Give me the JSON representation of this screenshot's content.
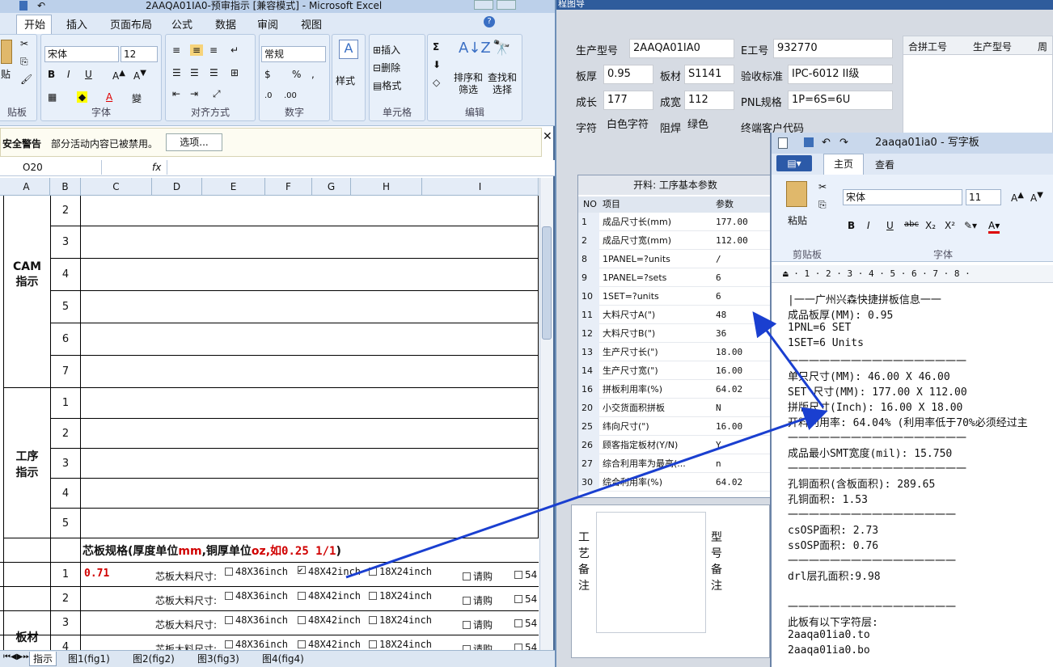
{
  "erp": {
    "title": "程图导",
    "form": [
      {
        "label": "生产型号",
        "value": "2AAQA01IA0"
      },
      {
        "label": "E工号",
        "value": "932770"
      },
      {
        "label": "板厚",
        "value": "0.95"
      },
      {
        "label": "板材",
        "value": "S1141"
      },
      {
        "label": "验收标准",
        "value": "IPC-6012 II级"
      },
      {
        "label": "成长",
        "value": "177"
      },
      {
        "label": "成宽",
        "value": "112"
      },
      {
        "label": "PNL规格",
        "value": "1P=6S=6U"
      },
      {
        "label": "字符",
        "value": "白色字符"
      },
      {
        "label": "阻焊",
        "value": "绿色"
      },
      {
        "label": "终端客户代码",
        "value": ""
      }
    ],
    "right_headers": [
      "合拼工号",
      "生产型号",
      "周期"
    ],
    "grid_title": "开料: 工序基本参数",
    "grid_headers": [
      "NO",
      "项目",
      "参数"
    ],
    "grid_rows": [
      {
        "no": "1",
        "item": "成品尺寸长(mm)",
        "val": "177.00"
      },
      {
        "no": "2",
        "item": "成品尺寸宽(mm)",
        "val": "112.00"
      },
      {
        "no": "8",
        "item": "1PANEL=?units",
        "val": "/"
      },
      {
        "no": "9",
        "item": "1PANEL=?sets",
        "val": "6"
      },
      {
        "no": "10",
        "item": "1SET=?units",
        "val": "6"
      },
      {
        "no": "11",
        "item": "大料尺寸A(\")",
        "val": "48"
      },
      {
        "no": "12",
        "item": "大料尺寸B(\")",
        "val": "36"
      },
      {
        "no": "13",
        "item": "生产尺寸长(\")",
        "val": "18.00"
      },
      {
        "no": "14",
        "item": "生产尺寸宽(\")",
        "val": "16.00"
      },
      {
        "no": "16",
        "item": "拼板利用率(%)",
        "val": "64.02"
      },
      {
        "no": "20",
        "item": "小交货面积拼板",
        "val": "N"
      },
      {
        "no": "25",
        "item": "纬向尺寸(\")",
        "val": "16.00"
      },
      {
        "no": "26",
        "item": "顾客指定板材(Y/N)",
        "val": "Y"
      },
      {
        "no": "27",
        "item": "综合利用率为最高(...",
        "val": "n"
      },
      {
        "no": "30",
        "item": "综合利用率(%)",
        "val": "64.02"
      }
    ],
    "remark1": "工艺备注",
    "remark2": "型号备注"
  },
  "excel": {
    "title": "2AAQA01IA0-预审指示 [兼容模式] - Microsoft Excel",
    "tabs": [
      "开始",
      "插入",
      "页面布局",
      "公式",
      "数据",
      "审阅",
      "视图"
    ],
    "font_name": "宋体",
    "font_size": "12",
    "number_format": "常规",
    "groups": {
      "clipboard": "贴板",
      "font": "字体",
      "align": "对齐方式",
      "number": "数字",
      "styles": "样式",
      "cells": "单元格",
      "edit": "编辑"
    },
    "paste": "贴",
    "cell_btns": [
      "插入",
      "删除",
      "格式"
    ],
    "edit_btns": [
      "排序和\n筛选",
      "查找和\n选择"
    ],
    "security_label": "安全警告",
    "security_msg": "部分活动内容已被禁用。",
    "options_btn": "选项...",
    "namebox": "O20",
    "fx": "fx",
    "columns": [
      "A",
      "B",
      "C",
      "D",
      "E",
      "F",
      "G",
      "H",
      "I"
    ],
    "cam_label": "CAM\n指示",
    "cam_rows": [
      "2",
      "3",
      "4",
      "5",
      "6",
      "7"
    ],
    "proc_label": "工序\n指示",
    "proc_rows": [
      "1",
      "2",
      "3",
      "4",
      "5"
    ],
    "board_label": "板材",
    "core_title_a": "芯板规格(厚度单位",
    "core_title_mm": "mm",
    "core_title_b": ",铜厚单位",
    "core_title_oz": "oz",
    "core_title_c": ",如",
    "core_title_d": "0.25 1/1",
    ")": ")",
    "core_close": ")",
    "core_rows": [
      {
        "n": "1",
        "v": "0.71"
      },
      {
        "n": "2",
        "v": ""
      },
      {
        "n": "3",
        "v": ""
      },
      {
        "n": "4",
        "v": ""
      }
    ],
    "spec_label": "芯板大料尺寸:",
    "opt1": "48X36inch",
    "opt2": "48X42inch",
    "opt3": "18X24inch",
    "buy": "请购",
    "tail": "54",
    "sheet_tabs": [
      "指示",
      "图1(fig1)",
      "图2(fig2)",
      "图3(fig3)",
      "图4(fig4)"
    ]
  },
  "wordpad": {
    "title": "2aaqa01ia0 - 写字板",
    "tabs": [
      "主页",
      "查看"
    ],
    "paste": "粘贴",
    "clipboard_grp": "剪贴板",
    "font_grp": "字体",
    "font_name": "宋体",
    "font_size": "11",
    "lines": [
      "|一一广州兴森快捷拼板信息一一",
      "成品板厚(MM): 0.95",
      "1PNL=6 SET",
      "1SET=6 Units",
      "一一一一一一一一一一一一一一一一一",
      "单只尺寸(MM): 46.00 X 46.00",
      "SET 尺寸(MM): 177.00 X 112.00",
      "拼版尺寸(Inch): 16.00 X 18.00",
      "开料利用率: 64.04% (利用率低于70%必须经过主",
      "一一一一一一一一一一一一一一一一一",
      "成品最小SMT宽度(mil): 15.750",
      "一一一一一一一一一一一一一一一一一",
      "孔铜面积(含板面积): 289.65",
      "孔铜面积: 1.53",
      "一一一一一一一一一一一一一一一一",
      "csOSP面积: 2.73",
      "ssOSP面积: 0.76",
      "一一一一一一一一一一一一一一一一",
      "drl层孔面积:9.98",
      "",
      "一一一一一一一一一一一一一一一一",
      "此板有以下字符层:",
      "2aaqa01ia0.to",
      "2aaqa01ia0.bo"
    ]
  },
  "colors": {
    "arrow": "#1a3fd0",
    "red_text": "#d00000",
    "excel_tab": "#ffffff",
    "ribbon": "#dfe9f6"
  }
}
